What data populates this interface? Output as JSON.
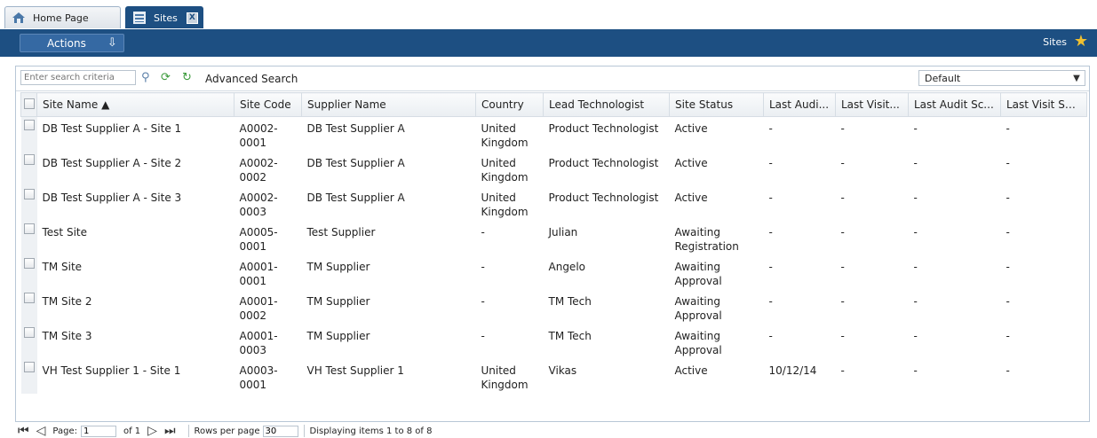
{
  "tabs": [
    {
      "label": "Home Page",
      "icon": "home-icon",
      "active": false
    },
    {
      "label": "Sites",
      "icon": "sites-icon",
      "active": true,
      "close": "X"
    }
  ],
  "toolbar": {
    "actions_label": "Actions",
    "page_label": "Sites"
  },
  "search": {
    "placeholder": "Enter search criteria",
    "advanced_label": "Advanced Search",
    "view": "Default"
  },
  "table": {
    "columns": [
      "Site Name ▲",
      "Site Code",
      "Supplier Name",
      "Country",
      "Lead Technologist",
      "Site Status",
      "Last Audi...",
      "Last Visit...",
      "Last Audit Sc...",
      "Last Visit Score"
    ],
    "rows": [
      [
        "DB Test Supplier A - Site 1",
        "A0002-0001",
        "DB Test Supplier A",
        "United Kingdom",
        "Product Technologist",
        "Active",
        "-",
        "-",
        "-",
        "-"
      ],
      [
        "DB Test Supplier A - Site 2",
        "A0002-0002",
        "DB Test Supplier A",
        "United Kingdom",
        "Product Technologist",
        "Active",
        "-",
        "-",
        "-",
        "-"
      ],
      [
        "DB Test Supplier A - Site 3",
        "A0002-0003",
        "DB Test Supplier A",
        "United Kingdom",
        "Product Technologist",
        "Active",
        "-",
        "-",
        "-",
        "-"
      ],
      [
        "Test Site",
        "A0005-0001",
        "Test Supplier",
        "-",
        "Julian",
        "Awaiting Registration",
        "-",
        "-",
        "-",
        "-"
      ],
      [
        "TM Site",
        "A0001-0001",
        "TM Supplier",
        "-",
        "Angelo",
        "Awaiting Approval",
        "-",
        "-",
        "-",
        "-"
      ],
      [
        "TM Site 2",
        "A0001-0002",
        "TM Supplier",
        "-",
        "TM Tech",
        "Awaiting Approval",
        "-",
        "-",
        "-",
        "-"
      ],
      [
        "TM Site 3",
        "A0001-0003",
        "TM Supplier",
        "-",
        "TM Tech",
        "Awaiting Approval",
        "-",
        "-",
        "-",
        "-"
      ],
      [
        "VH Test Supplier 1 - Site 1",
        "A0003-0001",
        "VH Test Supplier 1",
        "United Kingdom",
        "Vikas",
        "Active",
        "10/12/14",
        "-",
        "-",
        "-"
      ]
    ]
  },
  "pager": {
    "page_label": "Page:",
    "page_value": "1",
    "of_label": "of 1",
    "rows_label": "Rows per page",
    "rows_value": "30",
    "display": "Displaying items 1 to 8 of 8"
  },
  "colors": {
    "toolbar": "#1d4f82",
    "active_tab": "#1d4f82"
  }
}
